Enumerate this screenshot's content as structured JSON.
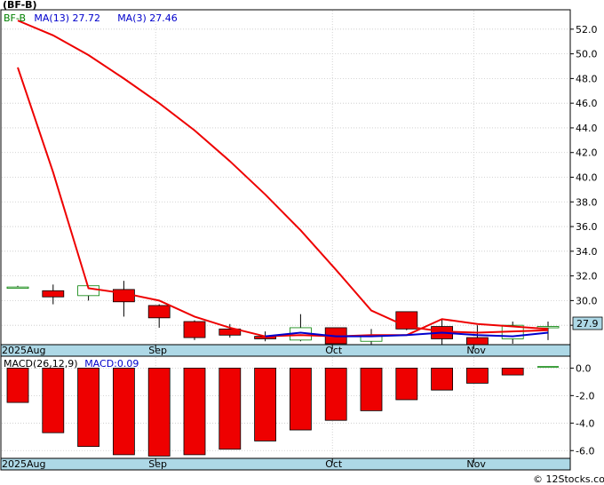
{
  "title": "(BF-B)",
  "footer": "© 12Stocks.com",
  "chart_data": [
    {
      "type": "candlestick",
      "ticker": "BF-B",
      "legend": [
        {
          "label": "BF-B",
          "color": "#008000"
        },
        {
          "label": "MA(13)",
          "value": "27.72",
          "color": "#0000cc"
        },
        {
          "label": "MA(3)",
          "value": "27.46",
          "color": "#0000cc"
        }
      ],
      "last_price_label": "27.9",
      "ylim": [
        26.5,
        53.5
      ],
      "y_ticks": [
        "28.0",
        "30.0",
        "32.0",
        "34.0",
        "36.0",
        "38.0",
        "40.0",
        "42.0",
        "44.0",
        "46.0",
        "48.0",
        "50.0",
        "52.0"
      ],
      "x_labels": [
        {
          "text": "2025Aug",
          "index": 0
        },
        {
          "text": "Sep",
          "index": 4
        },
        {
          "text": "Oct",
          "index": 9
        },
        {
          "text": "Nov",
          "index": 13
        }
      ],
      "candles": [
        {
          "open": 31.1,
          "high": 31.2,
          "low": 31.0,
          "close": 31.1
        },
        {
          "open": 30.8,
          "high": 31.3,
          "low": 29.7,
          "close": 30.3
        },
        {
          "open": 30.4,
          "high": 31.2,
          "low": 30.0,
          "close": 31.2
        },
        {
          "open": 30.9,
          "high": 31.6,
          "low": 28.7,
          "close": 29.9
        },
        {
          "open": 29.6,
          "high": 29.7,
          "low": 27.8,
          "close": 28.6
        },
        {
          "open": 28.3,
          "high": 28.4,
          "low": 26.8,
          "close": 27.0
        },
        {
          "open": 27.7,
          "high": 28.1,
          "low": 27.0,
          "close": 27.2
        },
        {
          "open": 27.1,
          "high": 27.5,
          "low": 26.7,
          "close": 26.9
        },
        {
          "open": 26.8,
          "high": 28.9,
          "low": 26.7,
          "close": 27.8
        },
        {
          "open": 27.8,
          "high": 27.8,
          "low": 26.5,
          "close": 26.5
        },
        {
          "open": 26.7,
          "high": 27.7,
          "low": 26.4,
          "close": 27.1
        },
        {
          "open": 29.1,
          "high": 29.1,
          "low": 27.6,
          "close": 27.7
        },
        {
          "open": 27.9,
          "high": 28.5,
          "low": 26.1,
          "close": 26.9
        },
        {
          "open": 27.0,
          "high": 28.0,
          "low": 26.2,
          "close": 26.2
        },
        {
          "open": 26.9,
          "high": 28.3,
          "low": 26.5,
          "close": 28.0
        },
        {
          "open": 27.9,
          "high": 28.3,
          "low": 26.8,
          "close": 27.9
        }
      ],
      "series": [
        {
          "name": "MA(3)",
          "color": "#ee0000",
          "points": [
            [
              0,
              52.7
            ],
            [
              1,
              51.5
            ],
            [
              2,
              49.9
            ],
            [
              3,
              48.0
            ],
            [
              4,
              46.0
            ],
            [
              5,
              43.8
            ],
            [
              6,
              41.3
            ],
            [
              7,
              38.6
            ],
            [
              8,
              35.7
            ],
            [
              9,
              32.5
            ],
            [
              10,
              29.2
            ],
            [
              11,
              27.9
            ],
            [
              12,
              27.5
            ],
            [
              13,
              27.4
            ],
            [
              14,
              27.5
            ],
            [
              15,
              27.6
            ]
          ]
        },
        {
          "name": "MA(13)",
          "color": "#ee0000",
          "points": [
            [
              0,
              48.9
            ],
            [
              1,
              40.4
            ],
            [
              2,
              31.0
            ],
            [
              3,
              30.6
            ],
            [
              4,
              30.0
            ],
            [
              5,
              28.7
            ],
            [
              6,
              27.8
            ],
            [
              7,
              27.1
            ],
            [
              8,
              27.2
            ],
            [
              9,
              27.1
            ],
            [
              10,
              27.2
            ],
            [
              11,
              27.2
            ],
            [
              12,
              28.5
            ],
            [
              13,
              28.1
            ],
            [
              14,
              27.9
            ],
            [
              15,
              27.7
            ]
          ]
        },
        {
          "name": "MA(13)-blue",
          "color": "#0000cc",
          "points": [
            [
              7,
              27.1
            ],
            [
              8,
              27.4
            ],
            [
              9,
              27.1
            ],
            [
              10,
              27.1
            ],
            [
              11,
              27.2
            ],
            [
              12,
              27.4
            ],
            [
              13,
              27.2
            ],
            [
              14,
              27.1
            ],
            [
              15,
              27.4
            ]
          ]
        }
      ]
    },
    {
      "type": "bar",
      "legend": [
        {
          "label": "MACD(26,12,9)",
          "color": "#000000"
        },
        {
          "label": "MACD:",
          "value": "0.09",
          "color": "#0000cc"
        }
      ],
      "ylim": [
        -6.5,
        0.8
      ],
      "y_ticks": [
        "0.0",
        "-2.0",
        "-4.0",
        "-6.0"
      ],
      "x_labels": [
        {
          "text": "2025Aug",
          "index": 0
        },
        {
          "text": "Sep",
          "index": 4
        },
        {
          "text": "Oct",
          "index": 9
        },
        {
          "text": "Nov",
          "index": 13
        }
      ],
      "values": [
        -2.5,
        -4.7,
        -5.7,
        -6.3,
        -6.4,
        -6.3,
        -5.9,
        -5.3,
        -4.5,
        -3.8,
        -3.1,
        -2.3,
        -1.6,
        -1.1,
        -0.5,
        0.09
      ]
    }
  ]
}
